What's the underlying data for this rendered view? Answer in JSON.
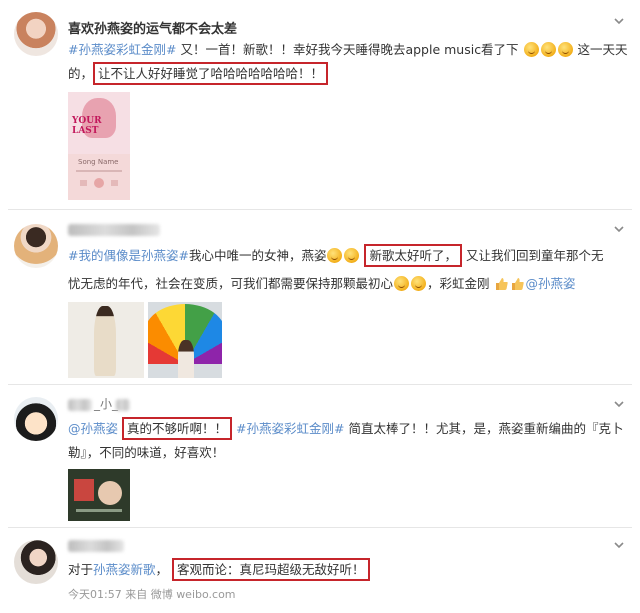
{
  "posts": [
    {
      "username": "喜欢孙燕姿的运气都不会太差",
      "line1": {
        "hashtag": "#孙燕姿彩虹金刚#",
        "text": "又！一首！新歌！！幸好我今天睡得晚去apple music看了下",
        "tail": "这一天天"
      },
      "line2": {
        "pre": "的，",
        "boxed": "让不让人好好睡觉了哈哈哈哈哈哈哈！！"
      },
      "album_text": "YOUR LAST",
      "player_caption": "Song Name"
    },
    {
      "line1": {
        "hashtag": "#我的偶像是孙燕姿#",
        "text": "我心中唯一的女神，燕姿",
        "boxed": "新歌太好听了，",
        "tail": "又让我们回到童年那个无"
      },
      "line2": {
        "text": "忧无虑的年代，社会在变质，可我们都需要保持那颗最初心",
        "text2": "，彩虹金刚",
        "mention": "@孙燕姿"
      }
    },
    {
      "username_suffix": "_小_",
      "line1": {
        "mention": "@孙燕姿",
        "boxed": "真的不够听啊！！",
        "hashtag": "#孙燕姿彩虹金刚#",
        "text": "简直太棒了！！尤其，是，燕姿重新编曲的『克卜"
      },
      "line2": {
        "text": "勒』，不同的味道，好喜欢！"
      }
    },
    {
      "line1": {
        "pre": "对于",
        "tag": "孙燕姿新歌",
        "boxed": "客观而论：真尼玛超级无敌好听！"
      },
      "footer": "今天01:57 来自 微博 weibo.com"
    }
  ],
  "colors": {
    "highlight_box": "#c6252b",
    "link": "#5b8cc9"
  },
  "icons": [
    "chevron-down-icon",
    "smile-emoji-icon",
    "shy-emoji-icon",
    "thumbs-up-icon"
  ]
}
